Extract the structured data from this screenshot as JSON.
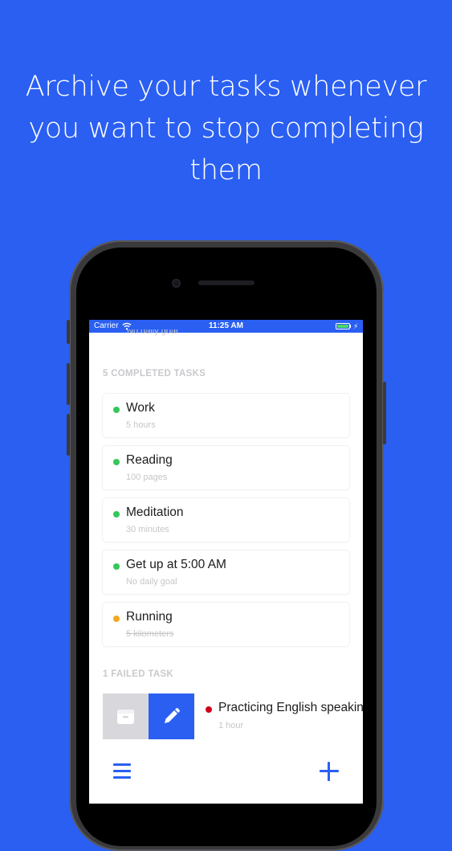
{
  "headline": {
    "line1": "Archive your tasks whenever",
    "line2": "you want to stop completing",
    "line3": "them"
  },
  "statusbar": {
    "carrier": "Carrier",
    "time": "11:25 AM",
    "charge_glyph": "⚡"
  },
  "cut_off_goal": "No daily goal",
  "completed_section": {
    "header": "5 COMPLETED TASKS",
    "tasks": [
      {
        "name": "Work",
        "goal": "5 hours",
        "status": "green"
      },
      {
        "name": "Reading",
        "goal": "100 pages",
        "status": "green"
      },
      {
        "name": "Meditation",
        "goal": "30 minutes",
        "status": "green"
      },
      {
        "name": "Get up at 5:00 AM",
        "goal": "No daily goal",
        "status": "green"
      },
      {
        "name": "Running",
        "goal": "5 kilometers",
        "status": "orange"
      }
    ]
  },
  "failed_section": {
    "header": "1 FAILED TASK",
    "tasks": [
      {
        "name": "Practicing English speaking",
        "goal": "1 hour",
        "status": "red"
      }
    ]
  },
  "icons": {
    "archive": "archive-box-icon",
    "edit": "pencil-icon",
    "menu": "hamburger-menu-icon",
    "add": "plus-icon",
    "wifi": "wifi-icon",
    "battery": "battery-icon"
  },
  "colors": {
    "brand_blue": "#2a5ff2",
    "status_green": "#34c759",
    "status_orange": "#f5a623",
    "status_red": "#d0021b",
    "archive_gray": "#d8d8dc"
  }
}
